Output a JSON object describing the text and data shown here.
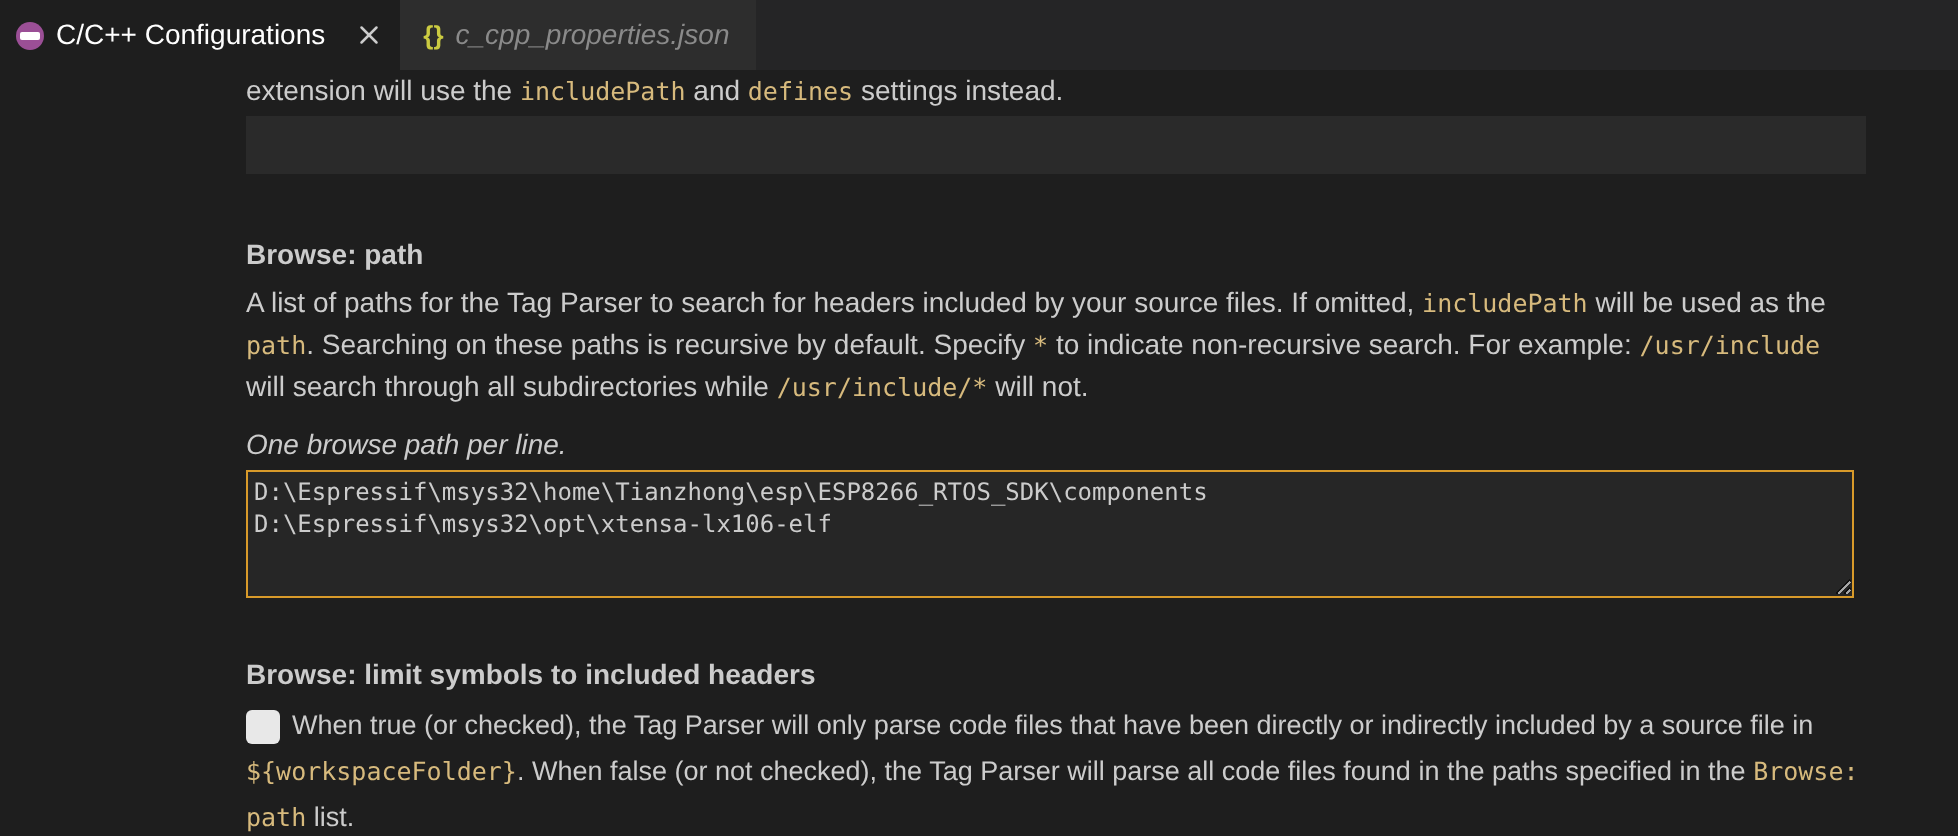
{
  "tabs": [
    {
      "kind": "extension",
      "label": "C/C++ Configurations",
      "selected": true,
      "italic": false,
      "closable": true
    },
    {
      "kind": "json",
      "label": "c_cpp_properties.json",
      "selected": false,
      "italic": true,
      "glyph": "{}",
      "closable": false
    }
  ],
  "intro": [
    {
      "kind": "text",
      "text": "extension will use the "
    },
    {
      "kind": "code",
      "text": "includePath"
    },
    {
      "kind": "text",
      "text": " and "
    },
    {
      "kind": "code",
      "text": "defines"
    },
    {
      "kind": "text",
      "text": " settings instead."
    }
  ],
  "sections": [
    {
      "kind": "textarea",
      "title": "Browse: path",
      "description": [
        {
          "kind": "text",
          "text": "A list of paths for the Tag Parser to search for headers included by your source files. If omitted, "
        },
        {
          "kind": "code",
          "text": "includePath"
        },
        {
          "kind": "text",
          "text": " will be used as the "
        },
        {
          "kind": "code",
          "text": "path"
        },
        {
          "kind": "text",
          "text": ". Searching on these paths is recursive by default. Specify "
        },
        {
          "kind": "code",
          "text": "*"
        },
        {
          "kind": "text",
          "text": " to indicate non-recursive search. For example: "
        },
        {
          "kind": "code",
          "text": "/usr/include"
        },
        {
          "kind": "text",
          "text": " will search through all subdirectories while "
        },
        {
          "kind": "code",
          "text": "/usr/include/*"
        },
        {
          "kind": "text",
          "text": " will not."
        }
      ],
      "hint": "One browse path per line.",
      "lines": [
        "D:\\Espressif\\msys32\\home\\Tianzhong\\esp\\ESP8266_RTOS_SDK\\components",
        "D:\\Espressif\\msys32\\opt\\xtensa-lx106-elf"
      ],
      "focused": true
    },
    {
      "kind": "checkbox",
      "title": "Browse: limit symbols to included headers",
      "checked": false,
      "description": [
        {
          "kind": "text",
          "text": "When true (or checked), the Tag Parser will only parse code files that have been directly or indirectly included by a source file in "
        },
        {
          "kind": "code",
          "text": "${workspaceFolder}"
        },
        {
          "kind": "text",
          "text": ". When false (or not checked), the Tag Parser will parse all code files found in the paths specified in the "
        },
        {
          "kind": "code",
          "text": "Browse: path"
        },
        {
          "kind": "text",
          "text": " list."
        }
      ]
    }
  ]
}
